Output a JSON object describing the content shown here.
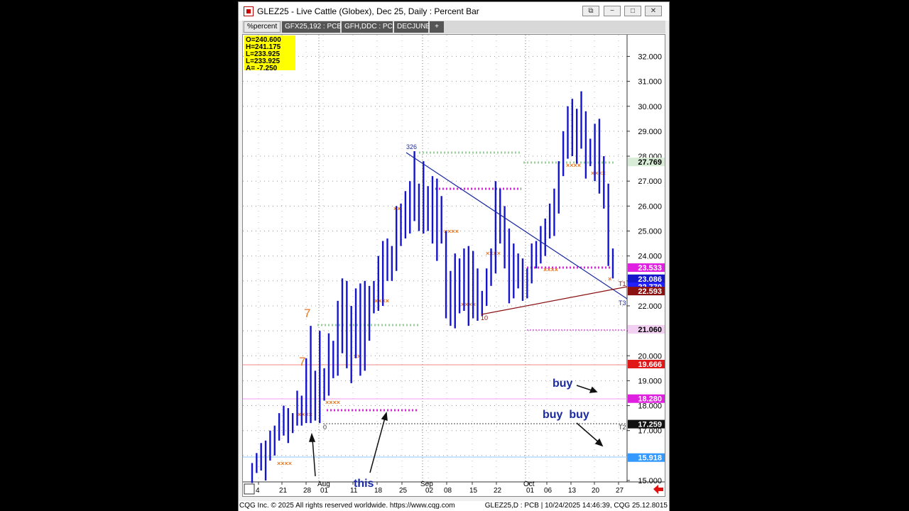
{
  "window": {
    "title": "GLEZ25 - Live Cattle (Globex), Dec 25, Daily : Percent Bar",
    "buttons": {
      "link": "⧉",
      "minimize": "−",
      "maximize": "□",
      "close": "✕"
    }
  },
  "tabs": [
    "%percent",
    "GFX25,192 : PCB",
    "GFH,DDC : PCB",
    "DECJUNE",
    "+"
  ],
  "ohlc_box": [
    "O=240.600",
    "H=241.175",
    "L=233.925",
    "L=233.925",
    "A= -7.250"
  ],
  "chart_data": {
    "type": "bar",
    "x_tick_labels": [
      "4",
      "21",
      "28",
      "01",
      "11",
      "18",
      "25",
      "02",
      "08",
      "15",
      "22",
      "01",
      "06",
      "13",
      "20",
      "27"
    ],
    "month_labels": [
      "Aug",
      "Sep",
      "Oct"
    ],
    "y_tick_labels": [
      "32.000",
      "31.000",
      "30.000",
      "29.000",
      "28.000",
      "27.000",
      "26.000",
      "25.000",
      "24.000",
      "23.000",
      "22.000",
      "21.000",
      "20.000",
      "19.000",
      "18.000",
      "17.000",
      "15.000"
    ],
    "ylim": [
      14.8,
      32.8
    ],
    "grid": true,
    "bars": [
      [
        0,
        15.7,
        14.9
      ],
      [
        1,
        16.1,
        15.3
      ],
      [
        2,
        16.5,
        15.4
      ],
      [
        3,
        16.6,
        15.0
      ],
      [
        4,
        17.0,
        15.8
      ],
      [
        5,
        17.2,
        16.0
      ],
      [
        6,
        17.7,
        16.6
      ],
      [
        7,
        18.0,
        16.8
      ],
      [
        8,
        17.9,
        16.5
      ],
      [
        9,
        17.7,
        16.9
      ],
      [
        10,
        18.6,
        17.2
      ],
      [
        11,
        18.4,
        17.2
      ],
      [
        12,
        19.9,
        17.3
      ],
      [
        13,
        21.2,
        17.3
      ],
      [
        14,
        19.4,
        17.4
      ],
      [
        15,
        21.0,
        17.3
      ],
      [
        16,
        19.5,
        18.2
      ],
      [
        17,
        20.9,
        18.4
      ],
      [
        18,
        20.6,
        19.1
      ],
      [
        19,
        22.2,
        19.2
      ],
      [
        20,
        23.1,
        20.1
      ],
      [
        21,
        23.0,
        19.5
      ],
      [
        22,
        22.0,
        18.9
      ],
      [
        23,
        22.7,
        19.9
      ],
      [
        24,
        22.9,
        19.2
      ],
      [
        25,
        23.0,
        19.4
      ],
      [
        26,
        22.8,
        20.6
      ],
      [
        27,
        23.0,
        21.7
      ],
      [
        28,
        24.0,
        21.8
      ],
      [
        29,
        24.6,
        22.0
      ],
      [
        30,
        24.7,
        23.0
      ],
      [
        31,
        24.4,
        23.0
      ],
      [
        32,
        26.0,
        23.4
      ],
      [
        33,
        26.1,
        24.4
      ],
      [
        34,
        26.6,
        24.7
      ],
      [
        35,
        27.0,
        24.9
      ],
      [
        36,
        28.2,
        25.4
      ],
      [
        37,
        26.9,
        25.0
      ],
      [
        38,
        27.8,
        24.9
      ],
      [
        39,
        26.8,
        25.0
      ],
      [
        40,
        27.2,
        24.5
      ],
      [
        41,
        27.1,
        23.8
      ],
      [
        42,
        26.4,
        24.5
      ],
      [
        43,
        25.0,
        21.5
      ],
      [
        44,
        23.4,
        21.2
      ],
      [
        45,
        24.1,
        21.1
      ],
      [
        46,
        23.9,
        21.7
      ],
      [
        47,
        24.3,
        21.8
      ],
      [
        48,
        24.4,
        21.2
      ],
      [
        49,
        24.2,
        21.5
      ],
      [
        50,
        23.5,
        21.4
      ],
      [
        51,
        22.6,
        21.6
      ],
      [
        52,
        23.5,
        22.0
      ],
      [
        53,
        24.3,
        22.8
      ],
      [
        54,
        27.0,
        23.3
      ],
      [
        55,
        26.7,
        24.5
      ],
      [
        56,
        26.0,
        23.5
      ],
      [
        57,
        25.1,
        22.1
      ],
      [
        58,
        24.5,
        22.3
      ],
      [
        59,
        24.1,
        22.7
      ],
      [
        60,
        23.9,
        22.2
      ],
      [
        61,
        23.5,
        22.3
      ],
      [
        62,
        24.5,
        22.9
      ],
      [
        63,
        24.6,
        23.5
      ],
      [
        64,
        25.2,
        23.7
      ],
      [
        65,
        25.5,
        24.0
      ],
      [
        66,
        26.1,
        24.7
      ],
      [
        67,
        26.7,
        24.8
      ],
      [
        68,
        27.8,
        25.7
      ],
      [
        69,
        29.0,
        27.2
      ],
      [
        70,
        30.0,
        27.9
      ],
      [
        71,
        30.3,
        28.0
      ],
      [
        72,
        29.9,
        27.7
      ],
      [
        73,
        30.6,
        28.3
      ],
      [
        74,
        29.8,
        27.1
      ],
      [
        75,
        28.7,
        27.6
      ],
      [
        76,
        29.3,
        27.0
      ],
      [
        77,
        29.5,
        26.5
      ],
      [
        78,
        28.0,
        25.9
      ],
      [
        79,
        26.9,
        23.6
      ],
      [
        80,
        24.3,
        23.1
      ]
    ],
    "price_tags": [
      {
        "label": "27.769",
        "value": 27.769,
        "bg": "#d8ecd8",
        "fg": "#000000"
      },
      {
        "label": "23.533",
        "value": 23.533,
        "bg": "#e020e0",
        "fg": "#ffffff"
      },
      {
        "label": "23.086",
        "value": 23.086,
        "bg": "#1515cc",
        "fg": "#ffffff"
      },
      {
        "label": "22.770",
        "value": 22.77,
        "bg": "#2020ff",
        "fg": "#ffffff"
      },
      {
        "label": "22.593",
        "value": 22.593,
        "bg": "#8b1010",
        "fg": "#ffffff"
      },
      {
        "label": "21.060",
        "value": 21.06,
        "bg": "#f2d0f2",
        "fg": "#000000"
      },
      {
        "label": "19.666",
        "value": 19.666,
        "bg": "#e01818",
        "fg": "#ffffff"
      },
      {
        "label": "18.280",
        "value": 18.28,
        "bg": "#e020e0",
        "fg": "#ffffff"
      },
      {
        "label": "17.259",
        "value": 17.259,
        "bg": "#111111",
        "fg": "#ffffff"
      },
      {
        "label": "15.918",
        "value": 15.918,
        "bg": "#3399ff",
        "fg": "#ffffff"
      }
    ],
    "markers": [
      "326",
      "10",
      "0",
      "T1",
      "T3",
      "T2"
    ],
    "countdown_labels": [
      "7",
      "7"
    ],
    "annotations": [
      "buy",
      "buy  buy",
      "this"
    ],
    "colors": {
      "bar": "#1515cc",
      "accent_orange": "#e87722",
      "magenta": "#e020e0",
      "trend_down": "#1a2aa0",
      "trend_up": "#8b1010"
    }
  },
  "footer": {
    "left": "CQG Inc. © 2025 All rights reserved worldwide. https://www.cqg.com",
    "right": "GLEZ25,D : PCB | 10/24/2025 14:46:39, CQG 25.12.8015"
  }
}
